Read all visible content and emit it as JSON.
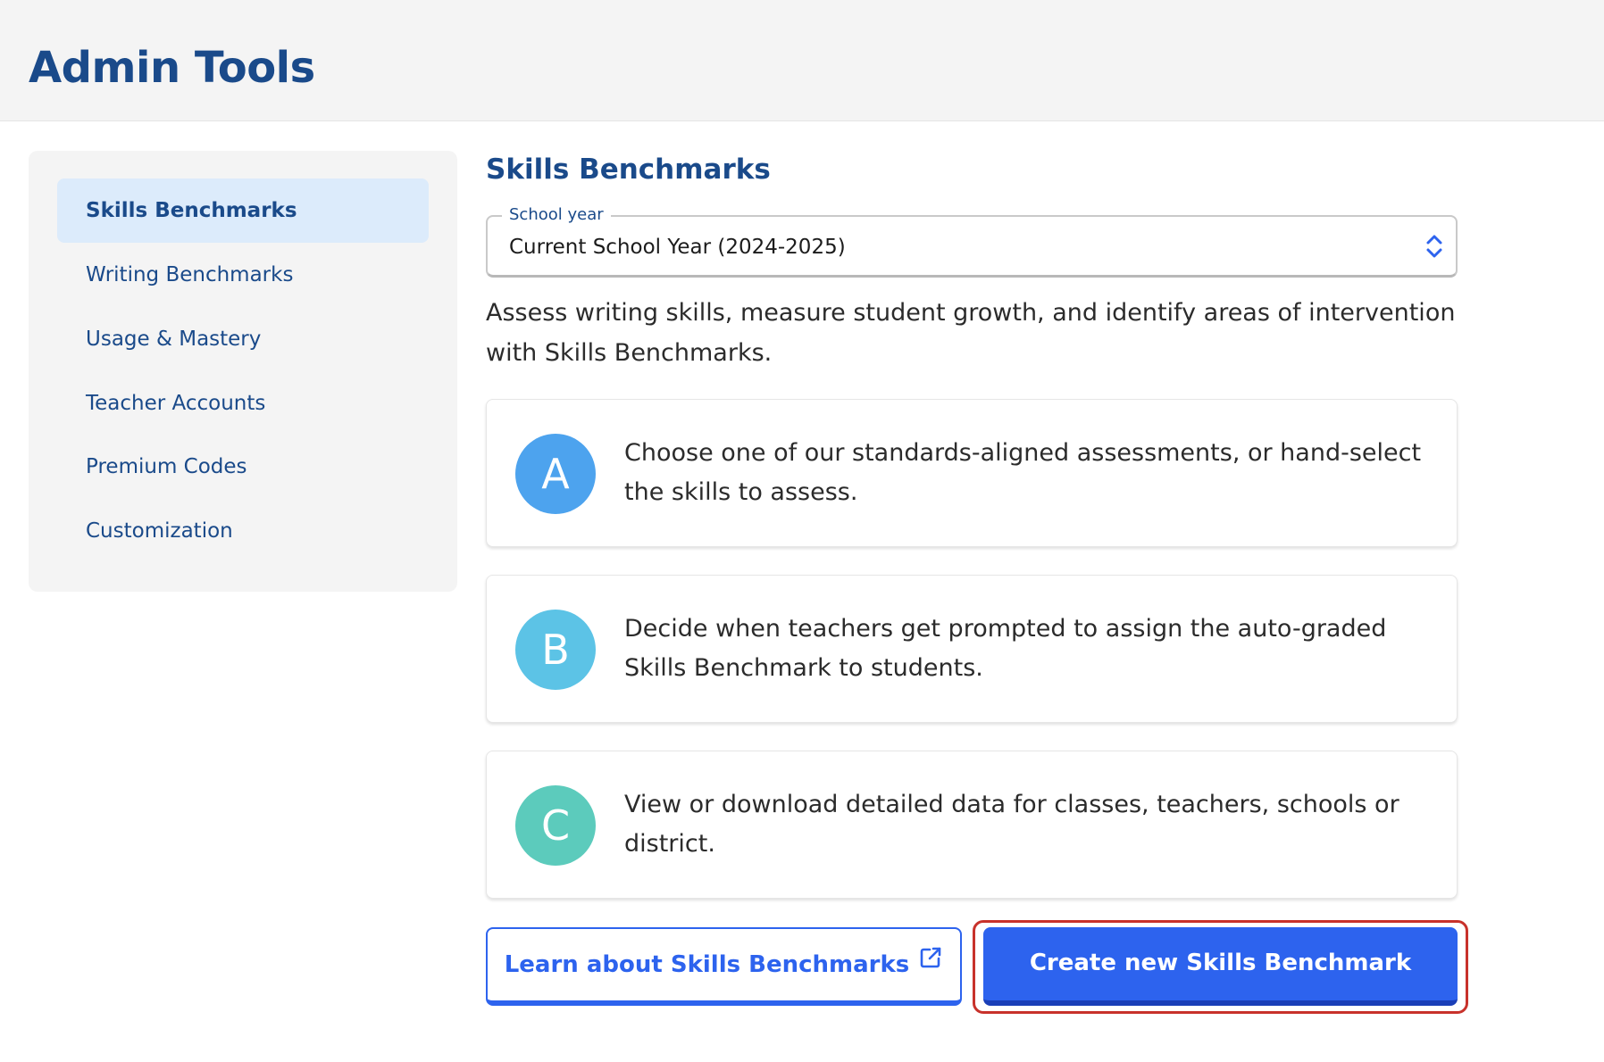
{
  "header": {
    "title": "Admin Tools"
  },
  "sidebar": {
    "items": [
      {
        "label": "Skills Benchmarks",
        "active": true
      },
      {
        "label": "Writing Benchmarks",
        "active": false
      },
      {
        "label": "Usage & Mastery",
        "active": false
      },
      {
        "label": "Teacher Accounts",
        "active": false
      },
      {
        "label": "Premium Codes",
        "active": false
      },
      {
        "label": "Customization",
        "active": false
      }
    ]
  },
  "main": {
    "title": "Skills Benchmarks",
    "school_year": {
      "label": "School year",
      "value": "Current School Year (2024-2025)",
      "icon": "chevron-up-down-icon"
    },
    "description": "Assess writing skills, measure student growth, and identify areas of intervention with Skills Benchmarks.",
    "steps": [
      {
        "letter": "A",
        "color": "#4da3ee",
        "text": "Choose one of our standards-aligned assessments, or hand-select the skills to assess."
      },
      {
        "letter": "B",
        "color": "#5cc3e6",
        "text": "Decide when teachers get prompted to assign the auto-graded Skills Benchmark to students."
      },
      {
        "letter": "C",
        "color": "#5ccbbc",
        "text": "View or download detailed data for classes, teachers, schools or district."
      }
    ],
    "buttons": {
      "learn_label": "Learn about Skills Benchmarks",
      "learn_icon": "external-link-icon",
      "create_label": "Create new Skills Benchmark"
    }
  },
  "colors": {
    "brand_navy": "#1a4a8a",
    "primary_blue": "#2d63ee",
    "active_nav_bg": "#dcebfb",
    "focus_ring": "#c8322b"
  }
}
